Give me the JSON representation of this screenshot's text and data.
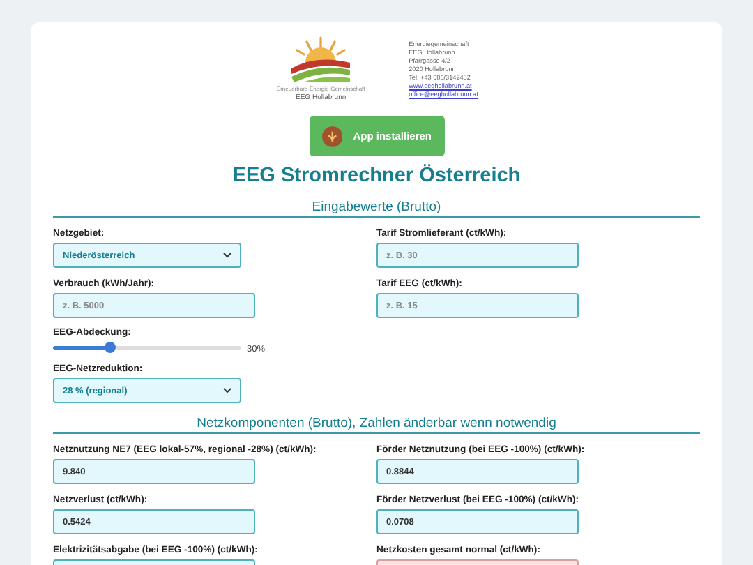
{
  "header": {
    "logo_caption": "EEG Hollabrunn",
    "logo_small": "Erneuerbare-Energie-Gemeinschaft",
    "address": [
      "Energiegemeinschaft",
      "EEG Hollabrunn",
      "Pfarrgasse 4/2",
      "2020 Hollabrunn",
      "Tel: +43 680/3142452"
    ],
    "links": [
      "www.eeghollabrunn.at",
      "office@eeghollabrunn.at"
    ],
    "install_button": "App installieren"
  },
  "title": "EEG Stromrechner Österreich",
  "sections": [
    {
      "heading": "Eingabewerte (Brutto)",
      "columns": [
        [
          {
            "kind": "select",
            "label": "Netzgebiet:",
            "value": "Niederösterreich"
          },
          {
            "kind": "input",
            "label": "Verbrauch (kWh/Jahr):",
            "placeholder": "z. B. 5000"
          },
          {
            "kind": "slider",
            "label": "EEG-Abdeckung:",
            "level": 0.3,
            "reading": "30%"
          },
          {
            "kind": "select",
            "label": "EEG-Netzreduktion:",
            "value": "28 % (regional)"
          }
        ],
        [
          {
            "kind": "input",
            "label": "Tarif Stromlieferant (ct/kWh):",
            "placeholder": "z. B. 30"
          },
          {
            "kind": "input",
            "label": "Tarif EEG (ct/kWh):",
            "placeholder": "z. B. 15"
          }
        ]
      ]
    },
    {
      "heading": "Netzkomponenten (Brutto), Zahlen änderbar wenn notwendig",
      "columns": [
        [
          {
            "kind": "input",
            "label": "Netznutzung NE7 (EEG lokal-57%, regional -28%) (ct/kWh):",
            "value": "9.840"
          },
          {
            "kind": "input",
            "label": "Netzverlust (ct/kWh):",
            "value": "0.5424"
          },
          {
            "kind": "input",
            "label": "Elektrizitätsabgabe (bei EEG -100%) (ct/kWh):"
          }
        ],
        [
          {
            "kind": "input",
            "label": "Förder Netznutzung (bei EEG -100%) (ct/kWh):",
            "value": "0.8844"
          },
          {
            "kind": "input",
            "label": "Förder Netzverlust (bei EEG -100%) (ct/kWh):",
            "value": "0.0708"
          },
          {
            "kind": "result",
            "label": "Netzkosten gesamt normal (ct/kWh):"
          }
        ]
      ]
    }
  ]
}
